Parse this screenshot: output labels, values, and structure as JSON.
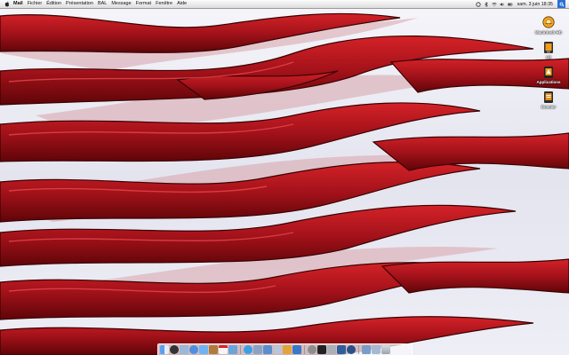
{
  "menubar": {
    "app_name": "Mail",
    "menus": [
      "Fichier",
      "Édition",
      "Présentation",
      "BAL",
      "Message",
      "Format",
      "Fenêtre",
      "Aide"
    ],
    "clock": "sam. 3 juin 18:35"
  },
  "desktop_icons": [
    {
      "label": "Macintosh HD",
      "icon": "hard-drive-icon"
    },
    {
      "label": "U3",
      "icon": "disk-icon"
    },
    {
      "label": "Applications",
      "icon": "folder-icon"
    },
    {
      "label": "Dossier",
      "icon": "folder-icon"
    }
  ],
  "dock": {
    "items": [
      "finder",
      "dashboard",
      "mail",
      "safari",
      "ichat",
      "address-book",
      "ical",
      "preview",
      "itunes",
      "iphoto",
      "imovie",
      "idvd",
      "garageband",
      "iweb",
      "system-preferences",
      "terminal",
      "utility",
      "app",
      "quicktime",
      "downloads",
      "documents",
      "trash"
    ]
  },
  "colors": {
    "flame": "#8e0c10",
    "flame_light": "#c21a1f",
    "sky": "#ececf5"
  }
}
